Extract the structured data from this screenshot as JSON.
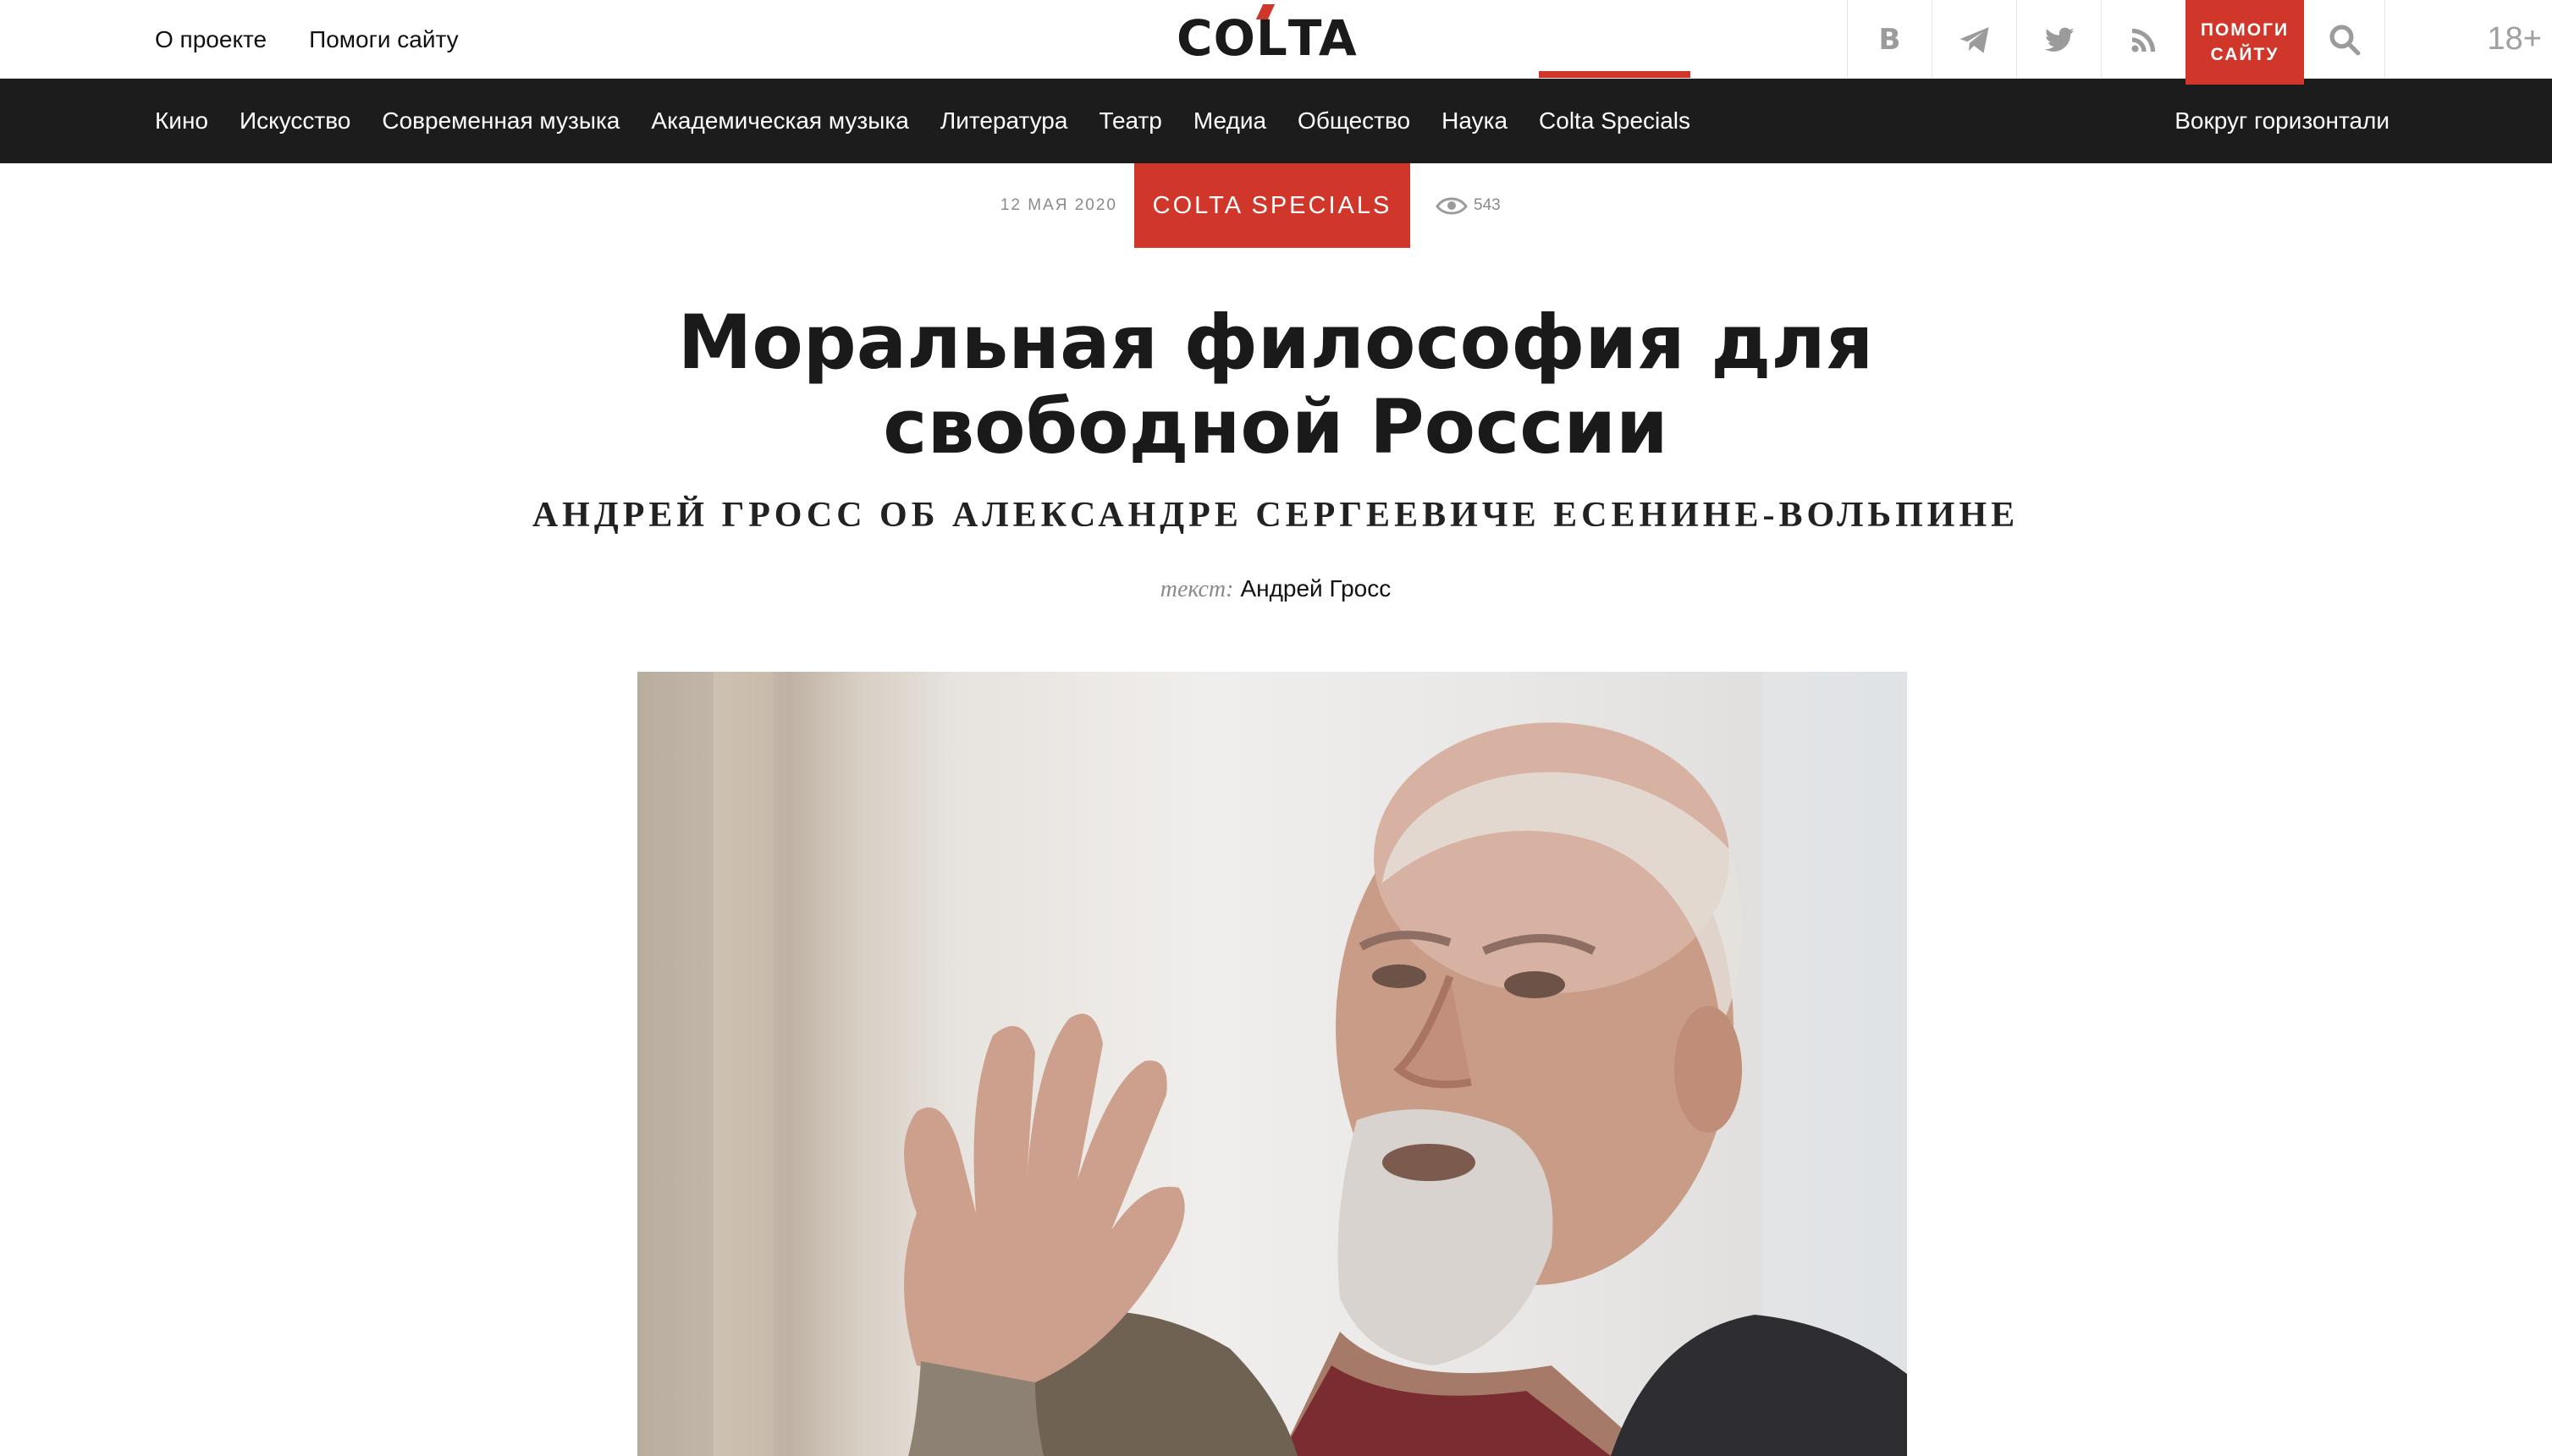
{
  "top_links": [
    "О проекте",
    "Помоги сайту"
  ],
  "logo": "COLTA",
  "toolbar": {
    "vk_label": "В",
    "icons": [
      "telegram-icon",
      "twitter-icon",
      "rss-icon",
      "search-icon"
    ],
    "help_label_line1": "помоги",
    "help_label_line2": "сайту",
    "age_rating": "18+"
  },
  "nav": {
    "items": [
      "Кино",
      "Искусство",
      "Современная музыка",
      "Академическая музыка",
      "Литература",
      "Театр",
      "Медиа",
      "Общество",
      "Наука",
      "Colta Specials"
    ],
    "active": "Colta Specials",
    "right": "Вокруг горизонтали"
  },
  "article": {
    "date": "12 мая 2020",
    "rubric": "Colta Specials",
    "views": "543",
    "title_line1": "Моральная философия для",
    "title_line2": "свободной России",
    "subtitle": "Андрей Гросс об Александре Сергеевиче Есенине-Вольпине",
    "byline_label": "текст:",
    "byline_author": "Андрей Гросс"
  },
  "colors": {
    "accent": "#d0362a",
    "nav_bg": "#1c1c1c",
    "muted": "#8a8a8a"
  }
}
